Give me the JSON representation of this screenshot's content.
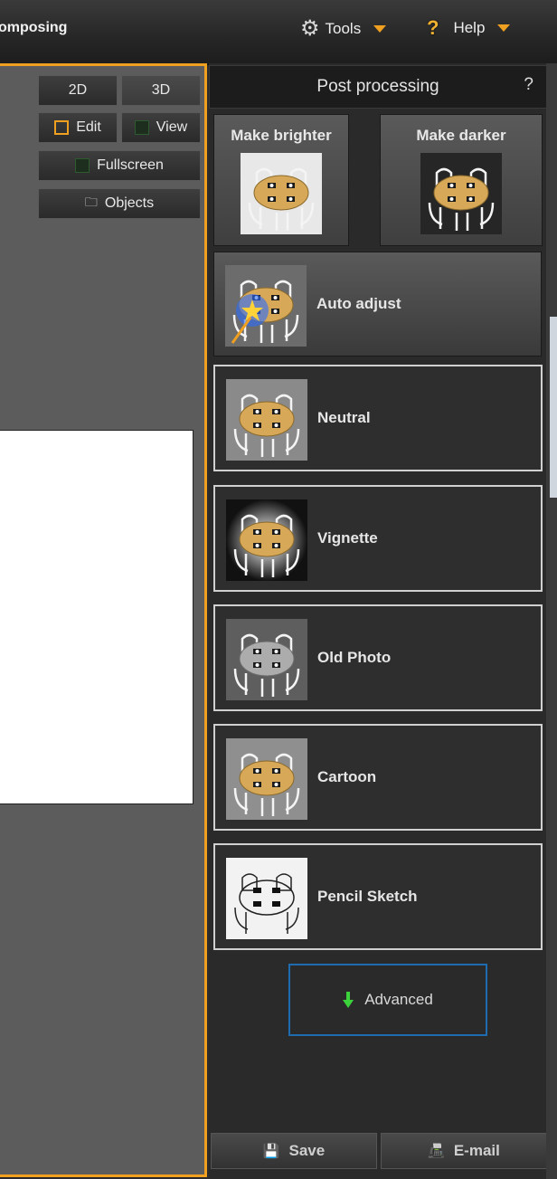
{
  "app": {
    "title": "omposing"
  },
  "menubar": {
    "tools_label": "Tools",
    "help_label": "Help"
  },
  "viewport": {
    "btn_2d": "2D",
    "btn_3d": "3D",
    "edit_label": "Edit",
    "view_label": "View",
    "fullscreen_label": "Fullscreen",
    "objects_label": "Objects"
  },
  "panel": {
    "title": "Post processing",
    "help": "?",
    "make_brighter": "Make brighter",
    "make_darker": "Make darker",
    "auto_adjust": "Auto adjust",
    "filters": [
      {
        "label": "Neutral"
      },
      {
        "label": "Vignette"
      },
      {
        "label": "Old Photo"
      },
      {
        "label": "Cartoon"
      },
      {
        "label": "Pencil Sketch"
      }
    ],
    "advanced_label": "Advanced",
    "save_label": "Save",
    "email_label": "E-mail"
  },
  "colors": {
    "accent": "#f0a020",
    "advanced_border": "#1e6bb0",
    "arrow_green": "#3cd23c"
  }
}
